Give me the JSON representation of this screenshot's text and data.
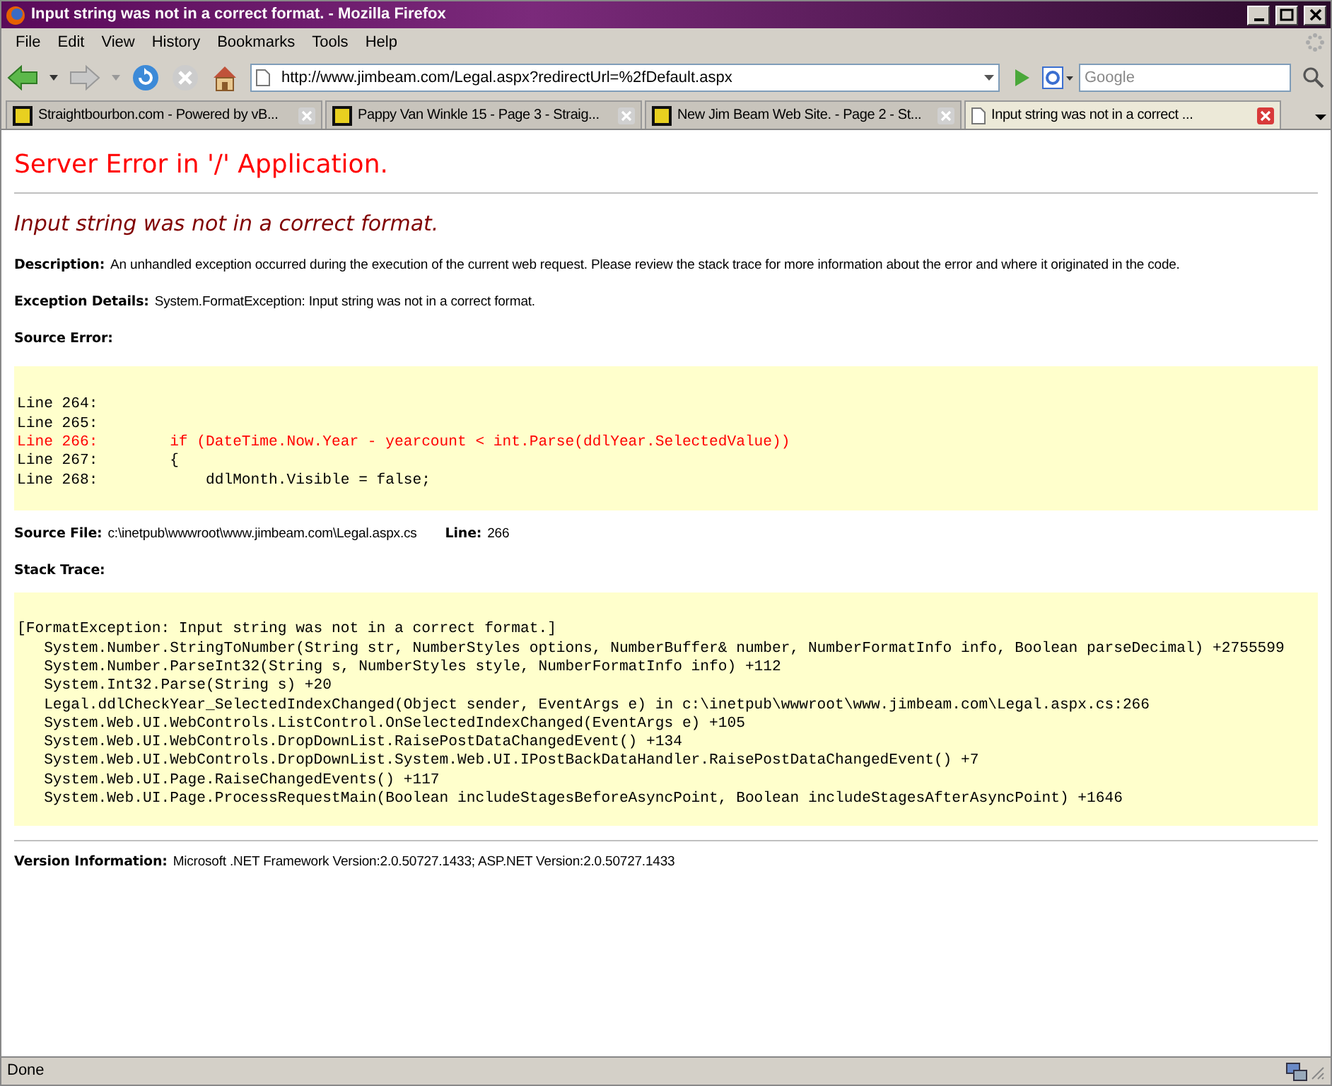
{
  "window": {
    "title": "Input string was not in a correct format. - Mozilla Firefox"
  },
  "menu": [
    "File",
    "Edit",
    "View",
    "History",
    "Bookmarks",
    "Tools",
    "Help"
  ],
  "toolbar": {
    "url": "http://www.jimbeam.com/Legal.aspx?redirectUrl=%2fDefault.aspx",
    "search_placeholder": "Google"
  },
  "tabs": [
    {
      "label": "Straightbourbon.com - Powered by vB...",
      "kind": "site",
      "selected": false
    },
    {
      "label": "Pappy Van Winkle 15 - Page 3 - Straig...",
      "kind": "site",
      "selected": false
    },
    {
      "label": "New Jim Beam Web Site. - Page 2 - St...",
      "kind": "site",
      "selected": false
    },
    {
      "label": "Input string was not in a correct ...",
      "kind": "page",
      "selected": true
    }
  ],
  "page": {
    "heading": "Server Error in '/' Application.",
    "subheading": "Input string was not in a correct format.",
    "description": {
      "label": "Description:",
      "text": "An unhandled exception occurred during the execution of the current web request. Please review the stack trace for more information about the error and where it originated in the code."
    },
    "exception_details": {
      "label": "Exception Details:",
      "text": "System.FormatException: Input string was not in a correct format."
    },
    "source_error_label": "Source Error:",
    "source_lines": [
      {
        "text": "Line 264:",
        "error": false
      },
      {
        "text": "Line 265:",
        "error": false
      },
      {
        "text": "Line 266:        if (DateTime.Now.Year - yearcount < int.Parse(ddlYear.SelectedValue))",
        "error": true
      },
      {
        "text": "Line 267:        {",
        "error": false
      },
      {
        "text": "Line 268:            ddlMonth.Visible = false;",
        "error": false
      }
    ],
    "source_file": {
      "label": "Source File:",
      "text": "c:\\inetpub\\wwwroot\\www.jimbeam.com\\Legal.aspx.cs"
    },
    "line": {
      "label": "Line:",
      "text": "266"
    },
    "stack_trace_label": "Stack Trace:",
    "stack_lines": [
      "[FormatException: Input string was not in a correct format.]",
      "   System.Number.StringToNumber(String str, NumberStyles options, NumberBuffer& number, NumberFormatInfo info, Boolean parseDecimal) +2755599",
      "   System.Number.ParseInt32(String s, NumberStyles style, NumberFormatInfo info) +112",
      "   System.Int32.Parse(String s) +20",
      "   Legal.ddlCheckYear_SelectedIndexChanged(Object sender, EventArgs e) in c:\\inetpub\\wwwroot\\www.jimbeam.com\\Legal.aspx.cs:266",
      "   System.Web.UI.WebControls.ListControl.OnSelectedIndexChanged(EventArgs e) +105",
      "   System.Web.UI.WebControls.DropDownList.RaisePostDataChangedEvent() +134",
      "   System.Web.UI.WebControls.DropDownList.System.Web.UI.IPostBackDataHandler.RaisePostDataChangedEvent() +7",
      "   System.Web.UI.Page.RaiseChangedEvents() +117",
      "   System.Web.UI.Page.ProcessRequestMain(Boolean includeStagesBeforeAsyncPoint, Boolean includeStagesAfterAsyncPoint) +1646"
    ],
    "version": {
      "label": "Version Information:",
      "text": "Microsoft .NET Framework Version:2.0.50727.1433; ASP.NET Version:2.0.50727.1433"
    }
  },
  "status_bar": {
    "text": "Done"
  }
}
